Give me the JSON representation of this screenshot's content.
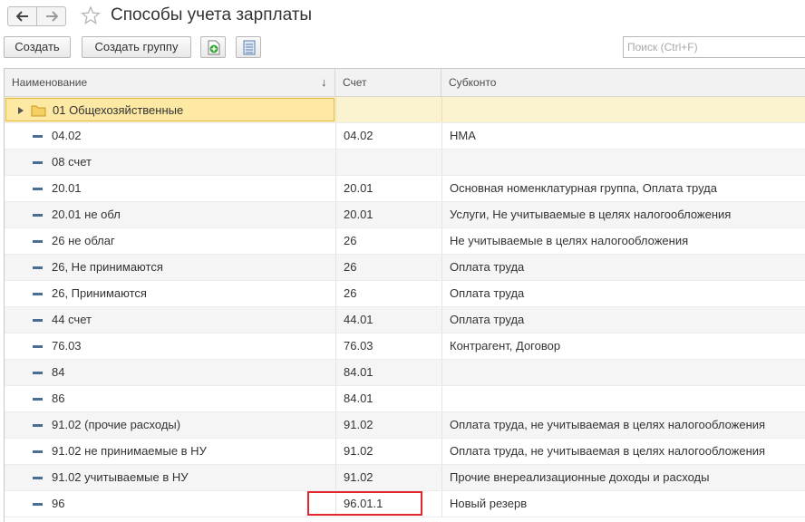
{
  "window": {
    "title": "Способы учета зарплаты",
    "back_icon": "arrow-left-icon",
    "forward_icon": "arrow-right-icon",
    "favorite_icon": "star-outline-icon"
  },
  "toolbar": {
    "create_label": "Создать",
    "create_group_label": "Создать группу",
    "copy_icon": "add-document-icon",
    "list_icon": "list-icon",
    "search_placeholder": "Поиск (Ctrl+F)"
  },
  "table": {
    "columns": {
      "name": "Наименование",
      "account": "Счет",
      "subconto": "Субконто"
    },
    "sort_indicator": "↓",
    "group_row": {
      "name": "01 Общехозяйственные",
      "icon": "folder-icon"
    },
    "rows": [
      {
        "name": "04.02",
        "account": "04.02",
        "subconto": "НМА"
      },
      {
        "name": "08 счет",
        "account": "",
        "subconto": ""
      },
      {
        "name": "20.01",
        "account": "20.01",
        "subconto": "Основная номенклатурная группа, Оплата труда"
      },
      {
        "name": "20.01 не обл",
        "account": "20.01",
        "subconto": "Услуги, Не учитываемые в целях налогообложения"
      },
      {
        "name": "26 не облаг",
        "account": "26",
        "subconto": "Не учитываемые в целях налогообложения"
      },
      {
        "name": "26, Не принимаются",
        "account": "26",
        "subconto": "Оплата труда"
      },
      {
        "name": "26, Принимаются",
        "account": "26",
        "subconto": "Оплата труда"
      },
      {
        "name": "44 счет",
        "account": "44.01",
        "subconto": "Оплата труда"
      },
      {
        "name": "76.03",
        "account": "76.03",
        "subconto": "Контрагент, Договор"
      },
      {
        "name": "84",
        "account": "84.01",
        "subconto": ""
      },
      {
        "name": "86",
        "account": "84.01",
        "subconto": ""
      },
      {
        "name": "91.02 (прочие расходы)",
        "account": "91.02",
        "subconto": "Оплата труда, не учитываемая в целях налогообложения"
      },
      {
        "name": "91.02 не принимаемые в НУ",
        "account": "91.02",
        "subconto": "Оплата труда, не учитываемая в целях налогообложения"
      },
      {
        "name": "91.02 учитываемые в НУ",
        "account": "91.02",
        "subconto": "Прочие внереализационные доходы и расходы"
      },
      {
        "name": "96",
        "account": "96.01.1",
        "subconto": "Новый резерв"
      }
    ]
  },
  "colors": {
    "group_row_bg": "#fbf3d0",
    "highlight_border": "#e2262b",
    "item_marker": "#4a6e91"
  }
}
